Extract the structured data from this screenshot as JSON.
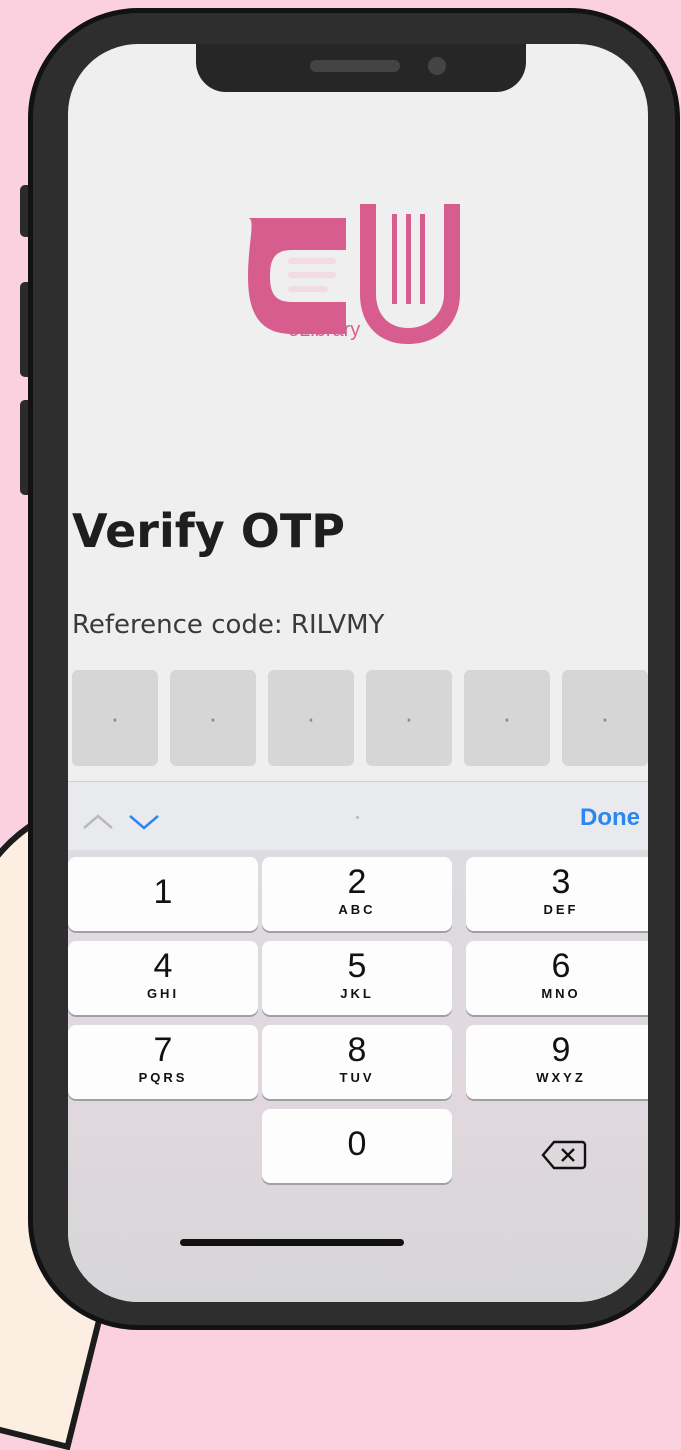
{
  "app": {
    "logo_text": "eLibrary",
    "accent": "#d85d8f"
  },
  "page": {
    "title": "Verify OTP",
    "reference_label": "Reference code:",
    "reference_code": "RILVMY"
  },
  "otp": {
    "slots": [
      "·",
      "·",
      "·",
      "·",
      "·",
      "·"
    ]
  },
  "toolbar": {
    "done_label": "Done",
    "up_icon": "chevron-up-icon",
    "down_icon": "chevron-down-icon"
  },
  "keypad": {
    "keys": [
      {
        "num": "1",
        "letters": ""
      },
      {
        "num": "2",
        "letters": "ABC"
      },
      {
        "num": "3",
        "letters": "DEF"
      },
      {
        "num": "4",
        "letters": "GHI"
      },
      {
        "num": "5",
        "letters": "JKL"
      },
      {
        "num": "6",
        "letters": "MNO"
      },
      {
        "num": "7",
        "letters": "PQRS"
      },
      {
        "num": "8",
        "letters": "TUV"
      },
      {
        "num": "9",
        "letters": "WXYZ"
      },
      {
        "num": "0",
        "letters": ""
      }
    ],
    "backspace_icon": "backspace-icon"
  }
}
